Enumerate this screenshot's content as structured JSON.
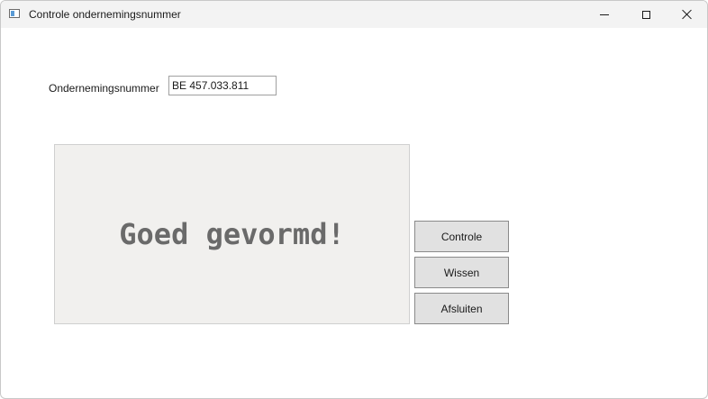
{
  "window": {
    "title": "Controle ondernemingsnummer"
  },
  "titlebar": {
    "icons": [
      "app-icon",
      "minimize-icon",
      "maximize-icon",
      "close-icon"
    ]
  },
  "form": {
    "label": "Ondernemingsnummer",
    "input_value": "BE 457.033.811"
  },
  "result": {
    "message": "Goed gevormd!"
  },
  "buttons": {
    "controle": "Controle",
    "wissen": "Wissen",
    "afsluiten": "Afsluiten"
  },
  "colors": {
    "titlebar_bg": "#f3f3f3",
    "panel_bg": "#f1f0ee",
    "result_text": "#6a6a6a",
    "button_bg": "#e1e1e1"
  }
}
